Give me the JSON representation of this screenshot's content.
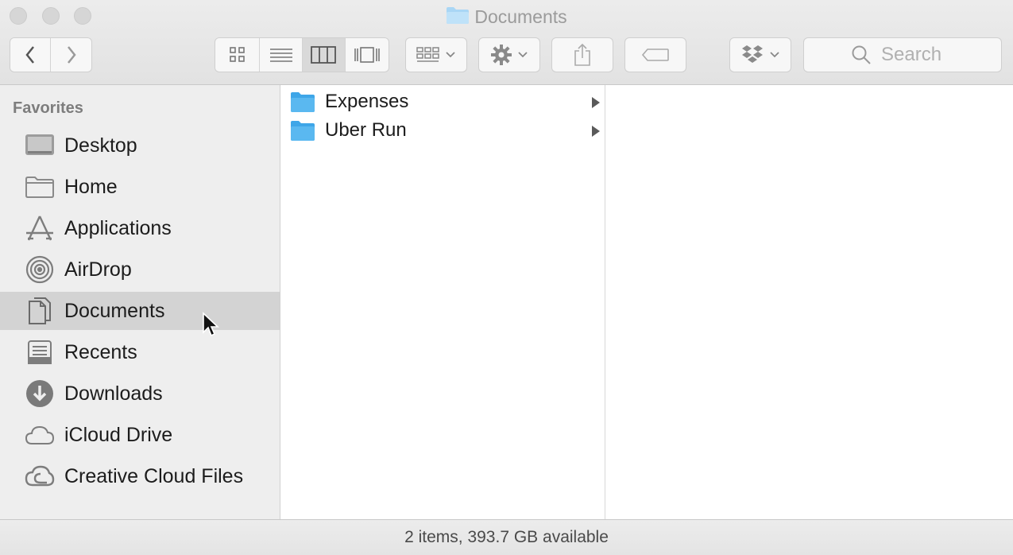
{
  "window": {
    "title": "Documents"
  },
  "search": {
    "placeholder": "Search"
  },
  "sidebar": {
    "heading": "Favorites",
    "items": [
      {
        "label": "Desktop",
        "icon": "desktop-icon"
      },
      {
        "label": "Home",
        "icon": "home-folder-icon"
      },
      {
        "label": "Applications",
        "icon": "applications-icon"
      },
      {
        "label": "AirDrop",
        "icon": "airdrop-icon"
      },
      {
        "label": "Documents",
        "icon": "documents-icon",
        "selected": true
      },
      {
        "label": "Recents",
        "icon": "recents-icon"
      },
      {
        "label": "Downloads",
        "icon": "downloads-icon"
      },
      {
        "label": "iCloud Drive",
        "icon": "icloud-icon"
      },
      {
        "label": "Creative Cloud Files",
        "icon": "creative-cloud-icon"
      }
    ]
  },
  "column1": {
    "items": [
      {
        "label": "Expenses",
        "icon": "folder-icon"
      },
      {
        "label": "Uber Run",
        "icon": "folder-icon"
      }
    ]
  },
  "status": {
    "text": "2 items, 393.7 GB available"
  },
  "colors": {
    "folder": "#5ab8f0",
    "selection": "#d3d3d3"
  }
}
